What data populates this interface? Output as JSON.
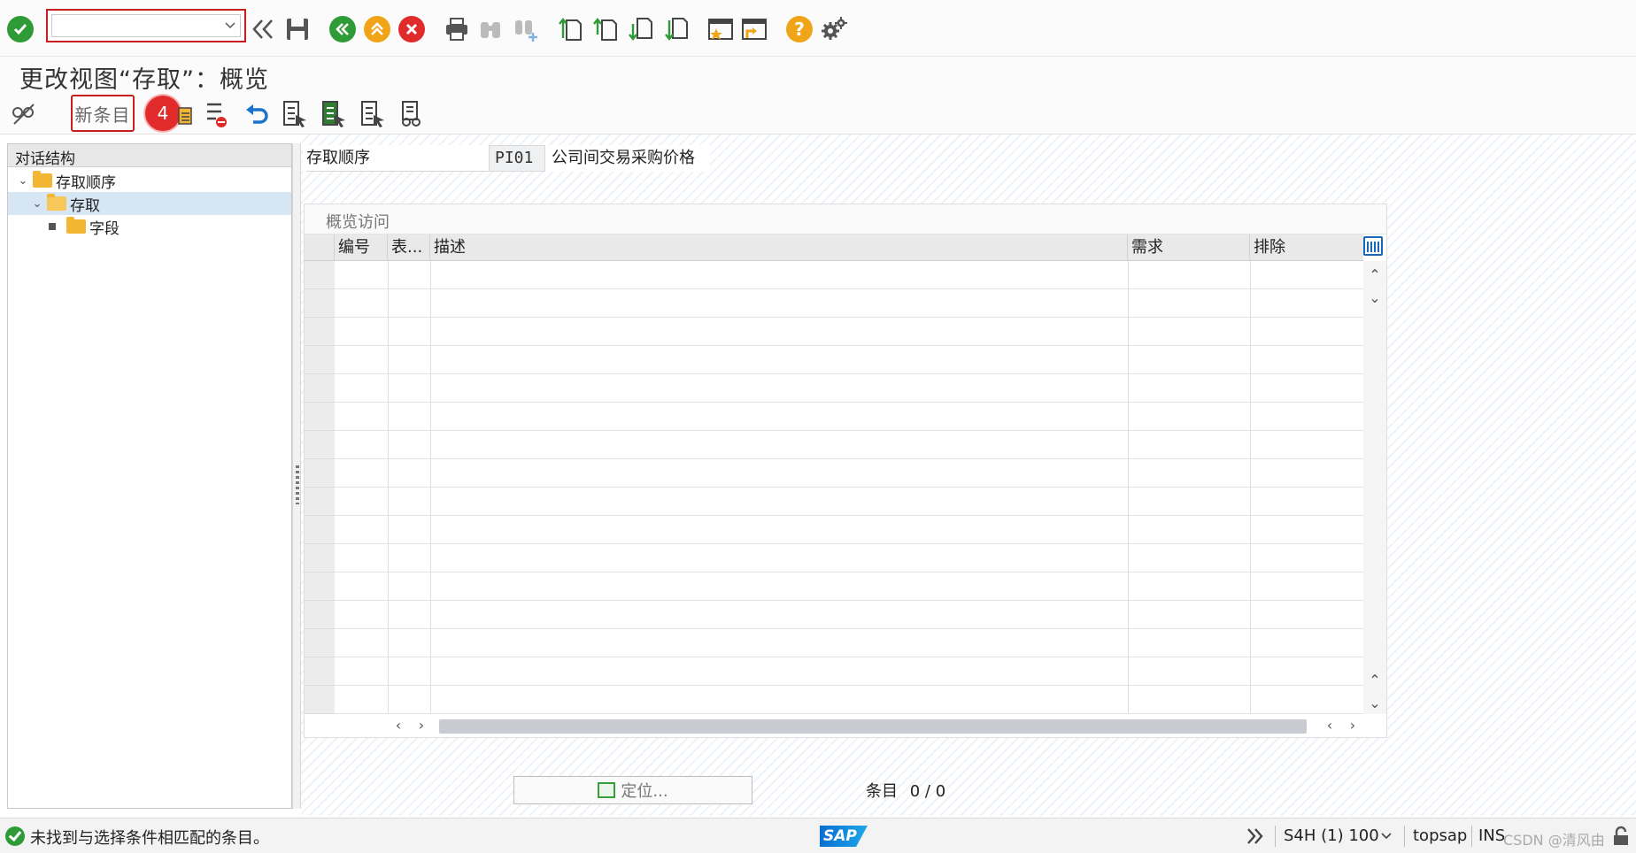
{
  "colors": {
    "accent_red": "#c81e1e",
    "ok_green": "#2e9b37",
    "cancel_red": "#e02b2b",
    "nav_orange": "#f0a417",
    "folder_yellow": "#f2b632",
    "sap_blue": "#0a6ed1"
  },
  "toolbar": {
    "command_placeholder": "",
    "icons": [
      "enter-icon",
      "history-back-icon",
      "save-icon",
      "back-icon",
      "exit-icon",
      "cancel-icon",
      "print-icon",
      "find-icon",
      "find-next-icon",
      "first-page-icon",
      "previous-page-icon",
      "next-page-icon",
      "last-page-icon",
      "create-session-icon",
      "shortcut-icon",
      "help-icon",
      "settings-icon"
    ]
  },
  "title": "更改视图“存取”：概览",
  "app_toolbar": {
    "new_entries_label": "新条目",
    "step_badge": "4"
  },
  "tree": {
    "header": "对话结构",
    "items": [
      {
        "label": "存取顺序",
        "level": 0
      },
      {
        "label": "存取",
        "level": 1,
        "selected": true
      },
      {
        "label": "字段",
        "level": 2
      }
    ]
  },
  "header_field": {
    "label": "存取顺序",
    "value": "PI01",
    "description": "公司间交易采购价格"
  },
  "table": {
    "title": "概览访问",
    "columns": [
      "编号",
      "表...",
      "描述",
      "需求",
      "排除"
    ],
    "rows": []
  },
  "position_button": "定位...",
  "entries_label": "条目",
  "entries_count": "0 / 0",
  "status": {
    "message": "未找到与选择条件相匹配的条目。",
    "system": "S4H (1) 100",
    "user": "topsap",
    "mode": "INS",
    "watermark": "CSDN @清风由"
  }
}
